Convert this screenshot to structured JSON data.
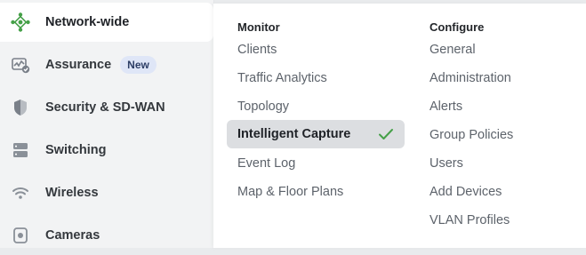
{
  "sidebar": {
    "items": [
      {
        "label": "Network-wide",
        "icon": "network-icon"
      },
      {
        "label": "Assurance",
        "icon": "assurance-icon",
        "badge": "New"
      },
      {
        "label": "Security & SD-WAN",
        "icon": "shield-icon"
      },
      {
        "label": "Switching",
        "icon": "switch-icon"
      },
      {
        "label": "Wireless",
        "icon": "wifi-icon"
      },
      {
        "label": "Cameras",
        "icon": "camera-icon"
      }
    ]
  },
  "menu": {
    "monitor": {
      "heading": "Monitor",
      "items": [
        "Clients",
        "Traffic Analytics",
        "Topology",
        "Intelligent Capture",
        "Event Log",
        "Map & Floor Plans"
      ],
      "selected": "Intelligent Capture"
    },
    "configure": {
      "heading": "Configure",
      "items": [
        "General",
        "Administration",
        "Alerts",
        "Group Policies",
        "Users",
        "Add Devices",
        "VLAN Profiles"
      ]
    }
  },
  "colors": {
    "accent": "#45a048",
    "selected_bg": "#dcdee1",
    "badge_bg": "#dfe6f7"
  }
}
